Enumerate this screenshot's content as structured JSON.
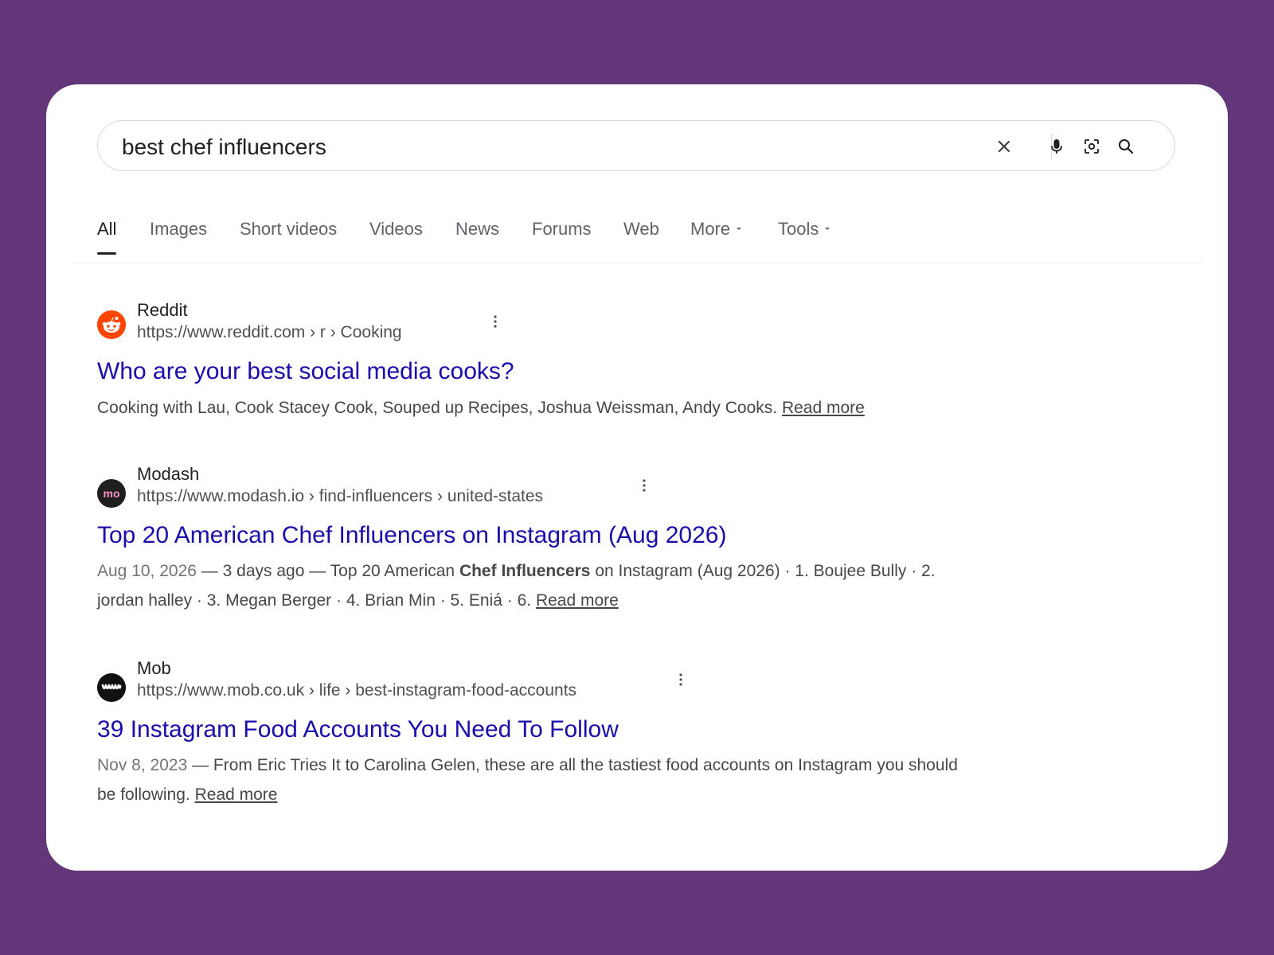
{
  "search": {
    "query": "best chef influencers",
    "clear_icon": "close-icon",
    "voice_icon": "microphone-icon",
    "lens_icon": "camera-lens-icon",
    "search_icon": "search-icon"
  },
  "tabs": [
    {
      "label": "All",
      "active": true
    },
    {
      "label": "Images"
    },
    {
      "label": "Short videos"
    },
    {
      "label": "Videos"
    },
    {
      "label": "News"
    },
    {
      "label": "Forums"
    },
    {
      "label": "Web"
    },
    {
      "label": "More",
      "dropdown": true
    },
    {
      "label": "Tools",
      "dropdown": true
    }
  ],
  "results": [
    {
      "site": "Reddit",
      "url": "https://www.reddit.com › r › Cooking",
      "title": "Who are your best social media cooks?",
      "snippet": "Cooking with Lau, Cook Stacey Cook, Souped up Recipes, Joshua Weissman, Andy Cooks.",
      "read_more": "Read more",
      "favicon_color": "#ff4500"
    },
    {
      "site": "Modash",
      "url": "https://www.modash.io › find-influencers › united-states",
      "title": "Top 20 American Chef Influencers on Instagram (Aug 2026)",
      "date": "Aug 10, 2026",
      "snippet_before": "— 3 days ago — Top 20 American",
      "snippet_bold": "Chef Influencers",
      "snippet_after": "on Instagram (Aug 2026) · 1. Boujee Bully · 2. jordan halley · 3. Megan Berger · 4. Brian Min · 5. Eniá · 6.",
      "read_more": "Read more",
      "favicon_text": "mo",
      "favicon_color": "#1f1f1f"
    },
    {
      "site": "Mob",
      "url": "https://www.mob.co.uk › life › best-instagram-food-accounts",
      "title": "39 Instagram Food Accounts You Need To Follow",
      "date": "Nov 8, 2023",
      "snippet": "— From Eric Tries It to Carolina Gelen, these are all the tastiest food accounts on Instagram you should be following.",
      "read_more": "Read more",
      "favicon_color": "#111111"
    }
  ],
  "colors": {
    "background": "#623678",
    "link": "#1a0dab"
  }
}
